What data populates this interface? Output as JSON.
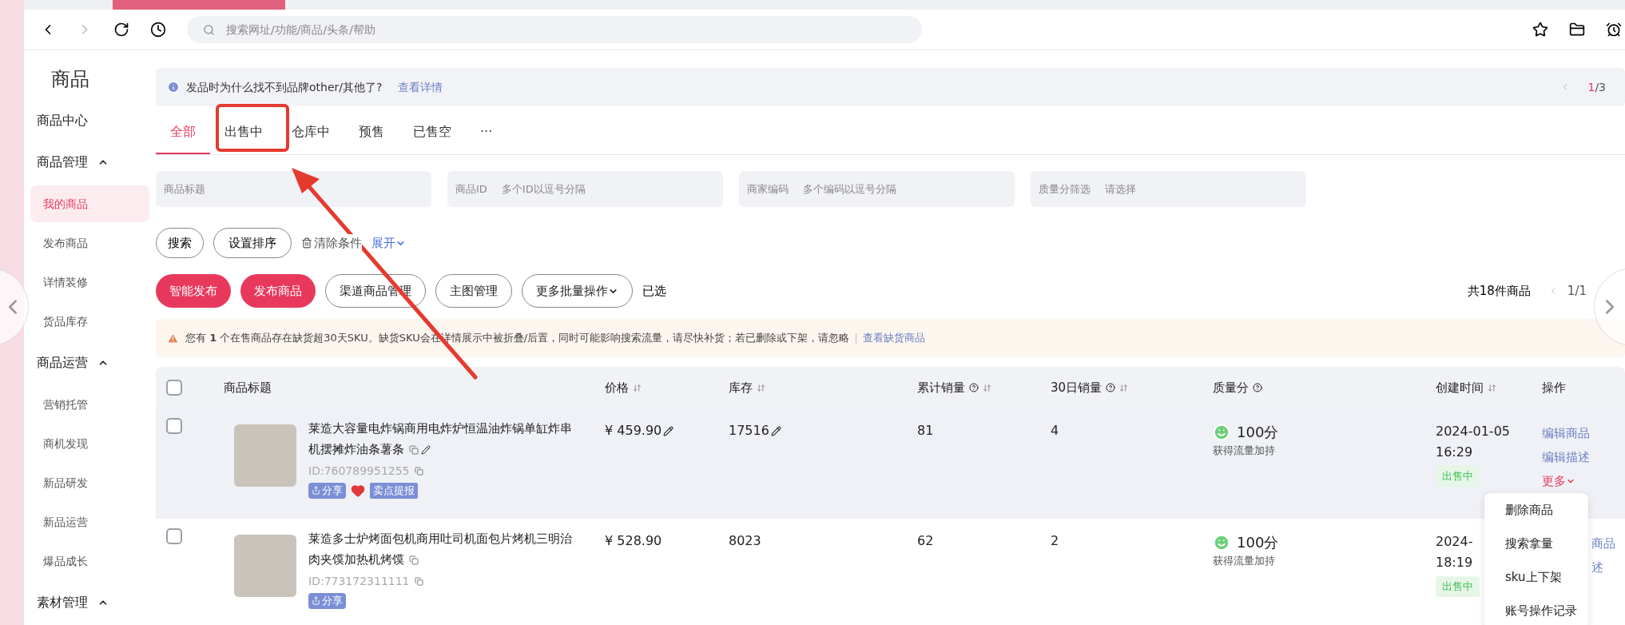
{
  "browser": {
    "address_placeholder": "搜索网址/功能/商品/头条/帮助"
  },
  "sidebar": {
    "title": "商品",
    "items": [
      {
        "label": "商品中心",
        "kind": "link",
        "selected": false
      },
      {
        "label": "商品管理",
        "kind": "group",
        "expanded": true,
        "children": [
          {
            "label": "我的商品",
            "selected": true
          },
          {
            "label": "发布商品",
            "selected": false
          },
          {
            "label": "详情装修",
            "selected": false
          },
          {
            "label": "货品库存",
            "selected": false
          }
        ]
      },
      {
        "label": "商品运营",
        "kind": "group",
        "expanded": true,
        "children": [
          {
            "label": "营销托管",
            "selected": false
          },
          {
            "label": "商机发现",
            "selected": false
          },
          {
            "label": "新品研发",
            "selected": false
          },
          {
            "label": "新品运营",
            "selected": false
          },
          {
            "label": "爆品成长",
            "selected": false
          }
        ]
      },
      {
        "label": "素材管理",
        "kind": "group",
        "expanded": true
      }
    ]
  },
  "notice": {
    "text": "发品时为什么找不到品牌other/其他了?",
    "link": "查看详情",
    "page_current": "1",
    "page_total": "/3"
  },
  "tabs": [
    {
      "label": "全部",
      "selected": true
    },
    {
      "label": "出售中",
      "selected": false
    },
    {
      "label": "仓库中",
      "selected": false
    },
    {
      "label": "预售",
      "selected": false
    },
    {
      "label": "已售空",
      "selected": false
    },
    {
      "label": "···",
      "selected": false
    }
  ],
  "filters": [
    {
      "placeholder": "商品标题"
    },
    {
      "label": "商品ID",
      "placeholder": "多个ID以逗号分隔"
    },
    {
      "label": "商家编码",
      "placeholder": "多个编码以逗号分隔"
    },
    {
      "label": "质量分筛选",
      "placeholder": "请选择"
    }
  ],
  "search_actions": {
    "search": "搜索",
    "sort": "设置排序",
    "clear": "清除条件",
    "expand": "展开"
  },
  "actions": [
    {
      "label": "智能发布",
      "kind": "primary"
    },
    {
      "label": "发布商品",
      "kind": "primary"
    },
    {
      "label": "渠道商品管理",
      "kind": "outline"
    },
    {
      "label": "主图管理",
      "kind": "outline"
    },
    {
      "label": "更多批量操作",
      "kind": "dropdown"
    }
  ],
  "selected_label": "已选",
  "total": "共18件商品",
  "list_page": "1/1",
  "warning": {
    "text": "您有 **1** 个在售商品存在缺货超30天SKU。缺货SKU会在详情展示中被折叠/后置，同时可能影响搜索流量，请尽快补货；若已删除或下架，请忽略",
    "link": "查看缺货商品"
  },
  "table": {
    "all_checked": false,
    "columns": [
      {
        "label": "商品标题",
        "sortable": false,
        "help": false
      },
      {
        "label": "价格",
        "sortable": true,
        "help": false
      },
      {
        "label": "库存",
        "sortable": true,
        "help": false
      },
      {
        "label": "累计销量",
        "sortable": true,
        "help": true
      },
      {
        "label": "30日销量",
        "sortable": true,
        "help": true
      },
      {
        "label": "质量分",
        "sortable": false,
        "help": true
      },
      {
        "label": "创建时间",
        "sortable": true,
        "help": false
      },
      {
        "label": "操作",
        "sortable": false,
        "help": false
      }
    ],
    "rows": [
      {
        "checked": false,
        "highlighted": true,
        "title": "莱造大容量电炸锅商用电炸炉恒温油炸锅单缸炸串机摆摊炸油条薯条",
        "title_editable": true,
        "id": "ID:760789951255",
        "tags": [
          {
            "kind": "share",
            "label": "分享"
          },
          {
            "kind": "heart"
          },
          {
            "kind": "tag",
            "label": "卖点提报"
          }
        ],
        "price": "¥ 459.90",
        "price_editable": true,
        "stock": "17516",
        "stock_editable": true,
        "sales_total": "81",
        "sales_30d": "4",
        "score": "100分",
        "score_note": "获得流量加持",
        "date": "2024-01-05",
        "time": "16:29",
        "status": "出售中",
        "ops": [
          "编辑商品",
          "编辑描述"
        ],
        "more": "更多",
        "menu": [
          "删除商品",
          "搜索拿量",
          "sku上下架",
          "账号操作记录"
        ]
      },
      {
        "checked": false,
        "highlighted": false,
        "title": "莱造多士炉烤面包机商用吐司机面包片烤机三明治肉夹馍加热机烤馍",
        "title_editable": false,
        "id": "ID:773172311111",
        "tags": [
          {
            "kind": "share",
            "label": "分享"
          }
        ],
        "price": "¥ 528.90",
        "price_editable": false,
        "stock": "8023",
        "stock_editable": false,
        "sales_total": "62",
        "sales_30d": "2",
        "score": "100分",
        "score_note": "获得流量加持",
        "date": "2024-",
        "time": "18:19",
        "status": "出售中",
        "ops": [
          "商品",
          "述"
        ]
      }
    ]
  }
}
